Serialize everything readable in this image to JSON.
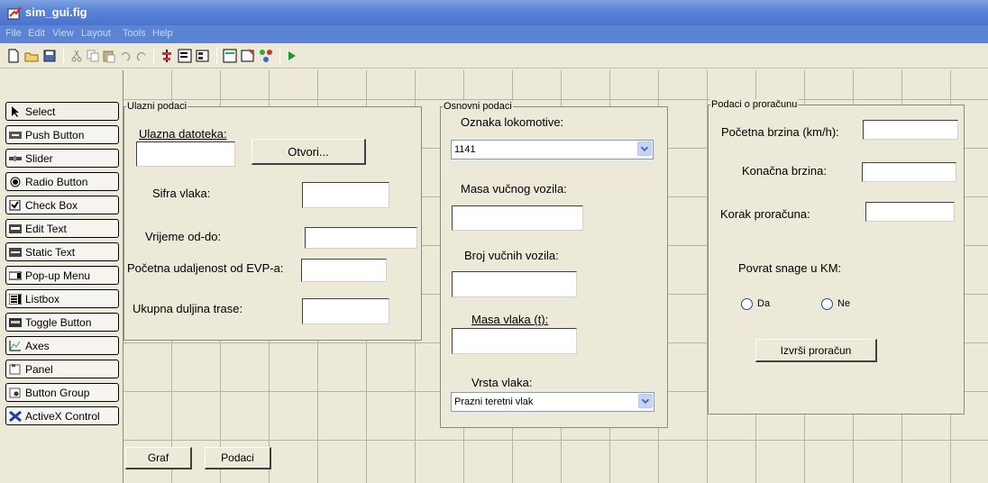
{
  "window": {
    "title": "sim_gui.fig"
  },
  "menu": [
    "File",
    "Edit",
    "View",
    "Layout",
    "Tools",
    "Help"
  ],
  "toolbar": {
    "icons": [
      "new-file-icon",
      "open-folder-icon",
      "save-icon",
      "cut-icon",
      "copy-icon",
      "paste-icon",
      "undo-icon",
      "redo-icon",
      "align-icon",
      "menu-editor-icon",
      "tab-order-icon",
      "mfile-editor-icon",
      "property-inspector-icon",
      "object-browser-icon",
      "run-icon"
    ]
  },
  "palette": [
    {
      "label": "Select",
      "icon": "arrow-cursor-icon"
    },
    {
      "label": "Push Button",
      "icon": "push-button-icon"
    },
    {
      "label": "Slider",
      "icon": "slider-icon"
    },
    {
      "label": "Radio Button",
      "icon": "radio-button-icon"
    },
    {
      "label": "Check Box",
      "icon": "check-box-icon"
    },
    {
      "label": "Edit Text",
      "icon": "edit-text-icon"
    },
    {
      "label": "Static Text",
      "icon": "static-text-icon"
    },
    {
      "label": "Pop-up Menu",
      "icon": "popup-menu-icon"
    },
    {
      "label": "Listbox",
      "icon": "listbox-icon"
    },
    {
      "label": "Toggle Button",
      "icon": "toggle-button-icon"
    },
    {
      "label": "Axes",
      "icon": "axes-icon"
    },
    {
      "label": "Panel",
      "icon": "panel-icon"
    },
    {
      "label": "Button Group",
      "icon": "button-group-icon"
    },
    {
      "label": "ActiveX Control",
      "icon": "activex-icon"
    }
  ],
  "panel_ulazni": {
    "title": "Ulazni podaci",
    "ulazna_label": "Ulazna datoteka:",
    "otvori_button": "Otvori...",
    "sifra_label": "Sifra vlaka:",
    "vrijeme_label": "Vrijeme od-do:",
    "pocetna_udaljenost_label": "Početna udaljenost od EVP-a:",
    "ukupna_duljina_label": "Ukupna duljina trase:"
  },
  "panel_osnovni": {
    "title": "Osnovni podaci",
    "oznaka_label": "Oznaka lokomotive:",
    "oznaka_value": "1141",
    "masa_vucnog_label": "Masa vučnog vozila:",
    "broj_vucnih_label": "Broj vučnih vozila:",
    "masa_vlaka_label": "Masa vlaka (t):",
    "vrsta_label": "Vrsta vlaka:",
    "vrsta_value": "Prazni teretni vlak"
  },
  "panel_proracun": {
    "title": "Podaci o proračunu",
    "pocetna_brzina_label": "Početna brzina (km/h):",
    "konacna_brzina_label": "Konačna brzina:",
    "korak_label": "Korak proračuna:",
    "povrat_label": "Povrat snage u KM:",
    "radio_da": "Da",
    "radio_ne": "Ne",
    "izvrsi_button": "Izvrši proračun"
  },
  "bottom_buttons": {
    "graf": "Graf",
    "podaci": "Podaci"
  }
}
